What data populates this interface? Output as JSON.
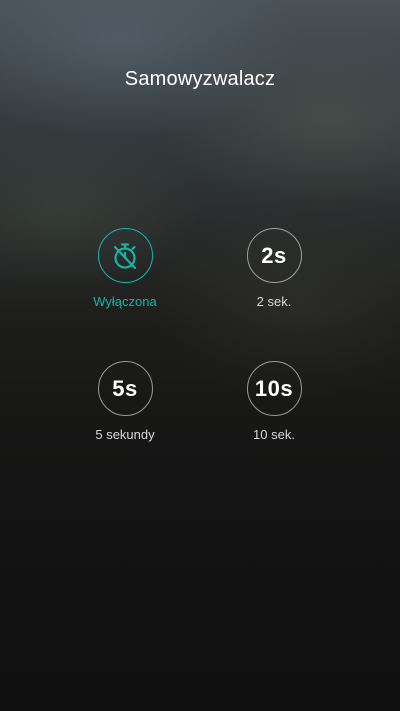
{
  "title": "Samowyzwalacz",
  "accent_color": "#19b3a4",
  "options": [
    {
      "icon": "timer-off-icon",
      "circle_text": "",
      "label": "Wyłączona",
      "selected": true
    },
    {
      "icon": "",
      "circle_text": "2s",
      "label": "2 sek.",
      "selected": false
    },
    {
      "icon": "",
      "circle_text": "5s",
      "label": "5 sekundy",
      "selected": false
    },
    {
      "icon": "",
      "circle_text": "10s",
      "label": "10 sek.",
      "selected": false
    }
  ]
}
